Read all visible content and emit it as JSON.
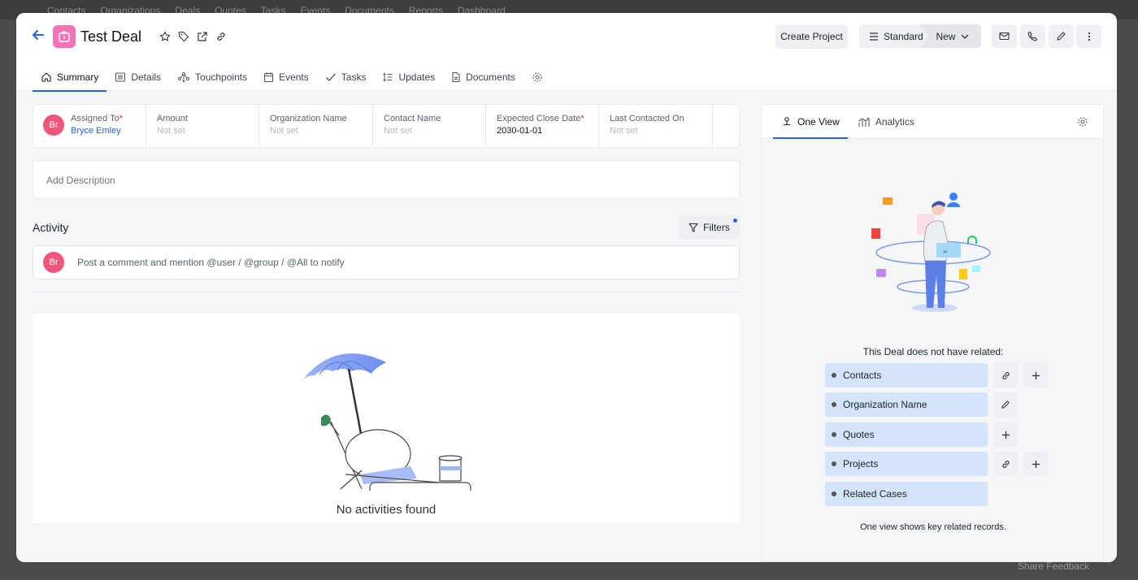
{
  "background_nav": [
    "Contacts",
    "Organizations",
    "Deals",
    "Quotes",
    "Tasks",
    "Events",
    "Documents",
    "Reports",
    "Dashboard"
  ],
  "background_feedback": "Share Feedback",
  "header": {
    "title": "Test Deal",
    "create_project": "Create Project",
    "pipeline": "Standard",
    "stage": "New"
  },
  "tabs": [
    {
      "label": "Summary",
      "icon": "home-icon"
    },
    {
      "label": "Details",
      "icon": "list-icon"
    },
    {
      "label": "Touchpoints",
      "icon": "network-icon"
    },
    {
      "label": "Events",
      "icon": "calendar-icon"
    },
    {
      "label": "Tasks",
      "icon": "check-icon"
    },
    {
      "label": "Updates",
      "icon": "updates-icon"
    },
    {
      "label": "Documents",
      "icon": "document-icon"
    }
  ],
  "fields": {
    "assigned_to": {
      "label": "Assigned To",
      "value": "Bryce Emley",
      "avatar": "Br"
    },
    "amount": {
      "label": "Amount",
      "value": "Not set"
    },
    "organization": {
      "label": "Organization Name",
      "value": "Not set"
    },
    "contact": {
      "label": "Contact Name",
      "value": "Not set"
    },
    "close_date": {
      "label": "Expected Close Date",
      "value": "2030-01-01"
    },
    "last_contacted": {
      "label": "Last Contacted On",
      "value": "Not set"
    }
  },
  "description_placeholder": "Add Description",
  "activity": {
    "title": "Activity",
    "filters": "Filters",
    "avatar": "Br",
    "comment_placeholder": "Post a comment and mention @user / @group / @All to notify",
    "empty": "No activities found"
  },
  "right": {
    "tab_one_view": "One View",
    "tab_analytics": "Analytics",
    "no_related": "This Deal does not have related:",
    "related": [
      {
        "label": "Contacts"
      },
      {
        "label": "Organization Name"
      },
      {
        "label": "Quotes"
      },
      {
        "label": "Projects"
      },
      {
        "label": "Related Cases"
      }
    ],
    "footer": "One view shows key related records."
  },
  "colors": {
    "accent": "#2563eb",
    "deal_icon": "#f472b6",
    "avatar": "#f0557a",
    "related_bg": "#d4e4fb"
  }
}
